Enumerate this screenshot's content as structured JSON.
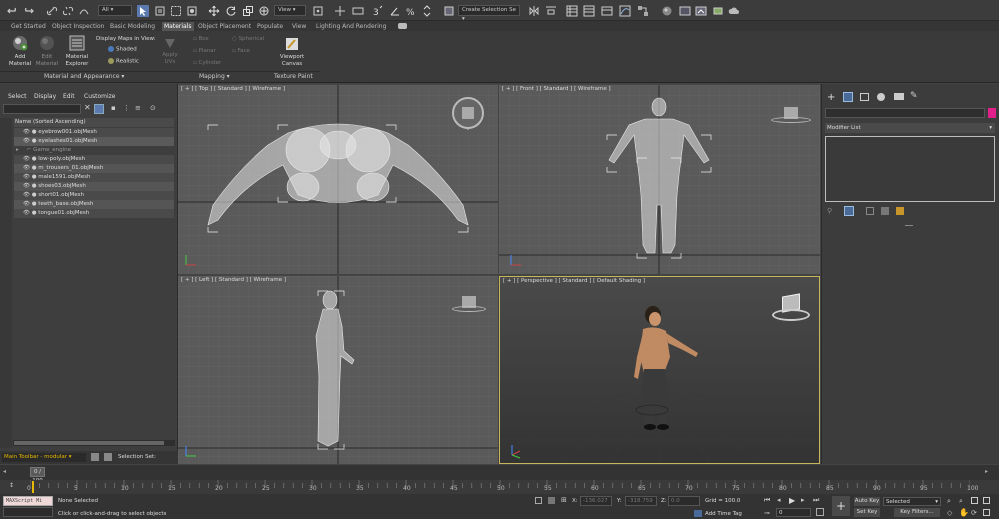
{
  "toolbar": {
    "filter_value": "All",
    "view_value": "View",
    "selection_set_placeholder": "Create Selection Se"
  },
  "ribbon": {
    "tabs": [
      "Get Started",
      "Object Inspection",
      "Basic Modeling",
      "Materials",
      "Object Placement",
      "Populate",
      "View",
      "Lighting And Rendering"
    ],
    "add_material": "Add\nMaterial",
    "edit_material": "Edit\nMaterial",
    "material_explorer": "Material\nExplorer",
    "display_maps": "Display Maps in View:",
    "shaded": "Shaded",
    "realistic": "Realistic",
    "apply_uvs": "Apply\nUVs",
    "box": "Box",
    "planar": "Planar",
    "cylinder": "Cylinder",
    "spherical": "Spherical",
    "face": "Face",
    "viewport_canvas": "Viewport\nCanvas",
    "group_material": "Material and Appearance ▾",
    "group_mapping": "Mapping ▾",
    "group_texture": "Texture Paint"
  },
  "scene_explorer": {
    "menu": [
      "Select",
      "Display",
      "Edit",
      "Customize"
    ],
    "header": "Name (Sorted Ascending)",
    "items": [
      "eyebrow001.objMesh",
      "eyelashes01.objMesh",
      "Game_engine",
      "low-poly.objMesh",
      "m_trousers_01.objMesh",
      "male1591.objMesh",
      "shoes03.objMesh",
      "short01.objMesh",
      "teeth_base.objMesh",
      "tongue01.objMesh"
    ],
    "layer_name": "Main Toolbar - modular",
    "selection_set": "Selection Set:"
  },
  "viewports": {
    "top": "[ + ] [ Top ] [ Standard ] [ Wireframe ]",
    "front": "[ + ] [ Front ] [ Standard ] [ Wireframe ]",
    "left": "[ + ] [ Left ] [ Standard ] [ Wireframe ]",
    "perspective": "[ + ] [ Perspective ] [ Standard ] [ Default Shading ]"
  },
  "command_panel": {
    "modifier_list": "Modifier List",
    "accent_color": "#e0218a"
  },
  "timeline": {
    "frame_counter": "0 / 100",
    "ticks": [
      "0",
      "5",
      "10",
      "15",
      "20",
      "25",
      "30",
      "35",
      "40",
      "45",
      "50",
      "55",
      "60",
      "65",
      "70",
      "75",
      "80",
      "85",
      "90",
      "95",
      "100"
    ]
  },
  "status": {
    "maxscript": "MAXScript Mi",
    "selection": "None Selected",
    "prompt": "Click or click-and-drag to select objects",
    "x_label": "X:",
    "x_value": "-136.027",
    "y_label": "Y:",
    "y_value": "-318.759",
    "z_label": "Z:",
    "z_value": "0.0",
    "grid": "Grid = 100.0",
    "add_time_tag": "Add Time Tag",
    "auto_key": "Auto Key",
    "set_key": "Set Key",
    "selected": "Selected",
    "key_filters": "Key Filters...",
    "frame": "0"
  }
}
